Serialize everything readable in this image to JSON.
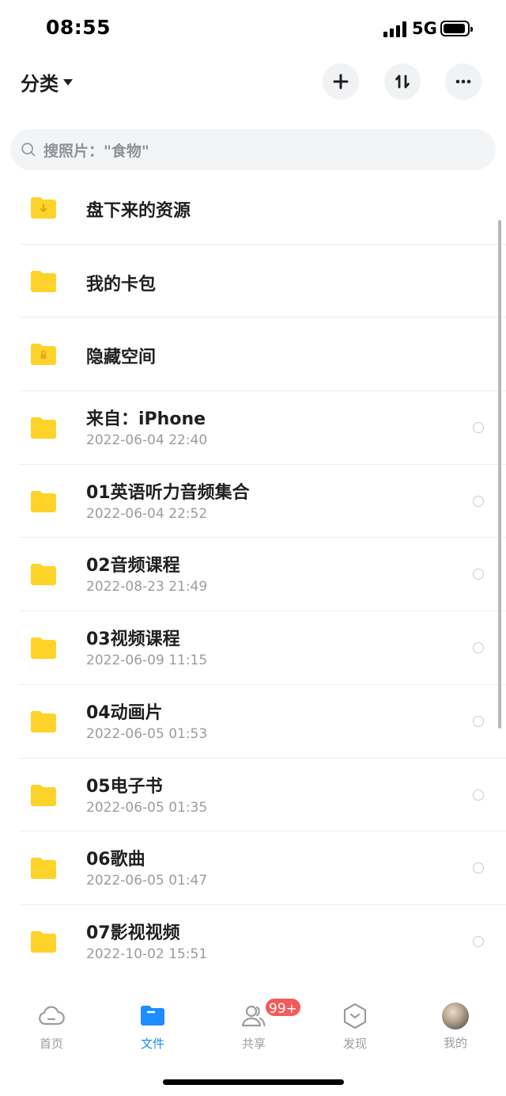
{
  "status": {
    "time": "08:55",
    "network": "5G"
  },
  "header": {
    "category_label": "分类"
  },
  "search": {
    "placeholder": "搜照片：\"食物\""
  },
  "colors": {
    "folder": "#fdd32a",
    "folder_dark": "#f7c520",
    "active_tab": "#1c8cff",
    "badge": "#f25b5b"
  },
  "files": [
    {
      "name": "盘下来的资源",
      "date": "",
      "icon": "download-folder-icon"
    },
    {
      "name": "我的卡包",
      "date": "",
      "icon": "folder-icon"
    },
    {
      "name": "隐藏空间",
      "date": "",
      "icon": "lock-folder-icon"
    },
    {
      "name": "来自：iPhone",
      "date": "2022-06-04 22:40",
      "icon": "folder-icon"
    },
    {
      "name": "01英语听力音频集合",
      "date": "2022-06-04 22:52",
      "icon": "folder-icon"
    },
    {
      "name": "02音频课程",
      "date": "2022-08-23 21:49",
      "icon": "folder-icon"
    },
    {
      "name": "03视频课程",
      "date": "2022-06-09 11:15",
      "icon": "folder-icon"
    },
    {
      "name": "04动画片",
      "date": "2022-06-05 01:53",
      "icon": "folder-icon"
    },
    {
      "name": "05电子书",
      "date": "2022-06-05 01:35",
      "icon": "folder-icon"
    },
    {
      "name": "06歌曲",
      "date": "2022-06-05 01:47",
      "icon": "folder-icon"
    },
    {
      "name": "07影视视频",
      "date": "2022-10-02 15:51",
      "icon": "folder-icon"
    }
  ],
  "tabs": [
    {
      "label": "首页",
      "icon": "cloud-icon",
      "active": false
    },
    {
      "label": "文件",
      "icon": "folder-icon",
      "active": true
    },
    {
      "label": "共享",
      "icon": "people-icon",
      "active": false
    },
    {
      "label": "发现",
      "icon": "discover-icon",
      "active": false
    },
    {
      "label": "我的",
      "icon": "avatar",
      "active": false
    }
  ],
  "badge": "99+"
}
